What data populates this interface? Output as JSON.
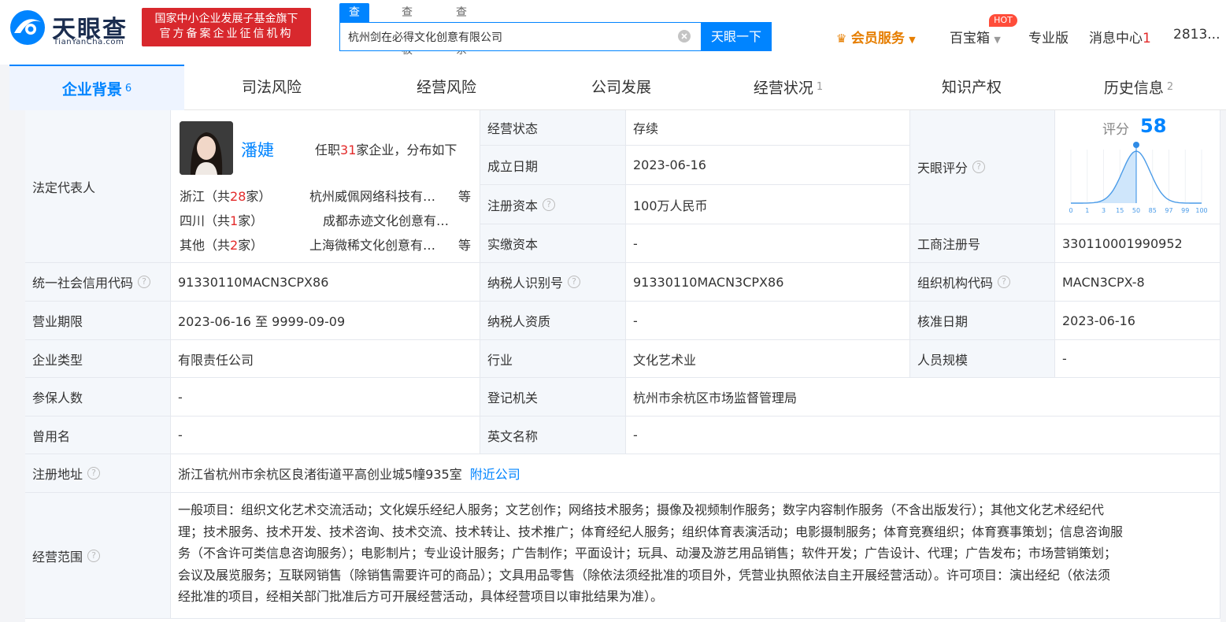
{
  "brand": {
    "name_cn": "天眼查",
    "name_en": "TianYanCha.com",
    "badge_line1": "国家中小企业发展子基金旗下",
    "badge_line2": "官方备案企业征信机构"
  },
  "search": {
    "tabs": [
      "查公司",
      "查老板",
      "查关系"
    ],
    "query": "杭州剑在必得文化创意有限公司",
    "button": "天眼一下"
  },
  "nav": {
    "vip": "会员服务",
    "box": "百宝箱",
    "hot": "HOT",
    "pro": "专业版",
    "msg": "消息中心",
    "msg_count": "1",
    "user": "2813..."
  },
  "tabs": [
    {
      "label": "企业背景",
      "count": "6"
    },
    {
      "label": "司法风险",
      "count": ""
    },
    {
      "label": "经营风险",
      "count": ""
    },
    {
      "label": "公司发展",
      "count": ""
    },
    {
      "label": "经营状况",
      "count": "1"
    },
    {
      "label": "知识产权",
      "count": ""
    },
    {
      "label": "历史信息",
      "count": "2"
    }
  ],
  "legal": {
    "label": "法定代表人",
    "name": "潘婕",
    "positions_pre": "任职",
    "positions_num": "31",
    "positions_post": "家企业，分布如下",
    "regions": [
      {
        "pre": "浙江（共",
        "num": "28",
        "post": "家）",
        "company": "杭州威佩网络科技有…",
        "suffix": "等"
      },
      {
        "pre": "四川（共",
        "num": "1",
        "post": "家）",
        "company": "成都赤迹文化创意有…",
        "suffix": ""
      },
      {
        "pre": "其他（共",
        "num": "2",
        "post": "家）",
        "company": "上海微稀文化创意有…",
        "suffix": "等"
      }
    ]
  },
  "fields": {
    "status_label": "经营状态",
    "status": "存续",
    "found_label": "成立日期",
    "found": "2023-06-16",
    "capital_label": "注册资本",
    "capital": "100万人民币",
    "paid_label": "实缴资本",
    "paid": "-",
    "score_label": "天眼评分",
    "reg_no_label": "工商注册号",
    "reg_no": "330110001990952",
    "credit_label": "统一社会信用代码",
    "credit": "91330110MACN3CPX86",
    "tax_label": "纳税人识别号",
    "tax": "91330110MACN3CPX86",
    "org_label": "组织机构代码",
    "org": "MACN3CPX-8",
    "term_label": "营业期限",
    "term": "2023-06-16 至 9999-09-09",
    "tax_q_label": "纳税人资质",
    "tax_q": "-",
    "approve_label": "核准日期",
    "approve": "2023-06-16",
    "type_label": "企业类型",
    "type": "有限责任公司",
    "industry_label": "行业",
    "industry": "文化艺术业",
    "staff_label": "人员规模",
    "staff": "-",
    "insured_label": "参保人数",
    "insured": "-",
    "authority_label": "登记机关",
    "authority": "杭州市余杭区市场监督管理局",
    "former_label": "曾用名",
    "former": "-",
    "en_label": "英文名称",
    "en": "-",
    "addr_label": "注册地址",
    "addr": "浙江省杭州市余杭区良渚街道平高创业城5幢935室",
    "nearby": "附近公司",
    "scope_label": "经营范围",
    "scope_lines": [
      "一般项目：组织文化艺术交流活动；文化娱乐经纪人服务；文艺创作；网络技术服务；摄像及视频制作服务；数字内容制作服务（不含出版发行）；其他文化艺术经纪代",
      "理；技术服务、技术开发、技术咨询、技术交流、技术转让、技术推广；体育经纪人服务；组织体育表演活动；电影摄制服务；体育竞赛组织；体育赛事策划；信息咨询服",
      "务（不含许可类信息咨询服务）；电影制片；专业设计服务；广告制作；平面设计；玩具、动漫及游艺用品销售；软件开发；广告设计、代理；广告发布；市场营销策划；",
      "会议及展览服务；互联网销售（除销售需要许可的商品）；文具用品零售（除依法须经批准的项目外，凭营业执照依法自主开展经营活动）。许可项目：演出经纪（依法须",
      "经批准的项目，经相关部门批准后方可开展经营活动，具体经营项目以审批结果为准）。"
    ]
  },
  "rating": {
    "title": "评分",
    "score": 58,
    "ticks": [
      "0",
      "1",
      "3",
      "15",
      "50",
      "85",
      "97",
      "99",
      "100"
    ]
  },
  "colors": {
    "accent": "#0084ff",
    "red": "#e32a2a",
    "vip": "#e67e00",
    "badge": "#d8282d"
  }
}
